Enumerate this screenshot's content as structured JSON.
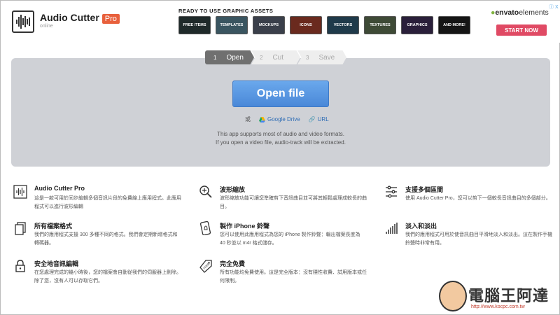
{
  "app": {
    "name": "Audio Cutter",
    "badge": "Pro",
    "status": "online"
  },
  "ad": {
    "title": "READY TO USE GRAPHIC ASSETS",
    "tiles": [
      {
        "label": "FREE ITEMS",
        "color": "#1f2a2a"
      },
      {
        "label": "TEMPLATES",
        "color": "#3a5560"
      },
      {
        "label": "MOCKUPS",
        "color": "#3a3f4a"
      },
      {
        "label": "ICONS",
        "color": "#6a2a1e"
      },
      {
        "label": "VECTORS",
        "color": "#1f3a4a"
      },
      {
        "label": "TEXTURES",
        "color": "#3e4a36"
      },
      {
        "label": "GRAPHICS",
        "color": "#2a1f3a"
      },
      {
        "label": "AND MORE!",
        "color": "#151515"
      }
    ],
    "brand_prefix": "envato",
    "brand_suffix": "elements",
    "cta": "START NOW",
    "close": "ⓘ X"
  },
  "steps": [
    {
      "num": "1",
      "label": "Open",
      "active": true
    },
    {
      "num": "2",
      "label": "Cut",
      "active": false
    },
    {
      "num": "3",
      "label": "Save",
      "active": false
    }
  ],
  "main": {
    "open_button": "Open file",
    "or": "或",
    "google_drive": "Google Drive",
    "url": "URL",
    "info_line1": "This app supports most of audio and video formats.",
    "info_line2": "If you open a video file, audio-track will be extracted."
  },
  "features": [
    {
      "icon": "waveform-icon",
      "title": "Audio Cutter Pro",
      "desc": "這是一款可用於同步編輯多個音訊片段的免費線上應用程式。此應用程式可以進行波形編輯"
    },
    {
      "icon": "zoom-in-icon",
      "title": "波形縮放",
      "desc": "波形縮放功能可讓您準確剪下音訊曲目並可將其輕鬆處理成較長的曲目。"
    },
    {
      "icon": "sliders-icon",
      "title": "支援多個區間",
      "desc": "使用 Audio Cutter Pro，您可以剪下一個較長音訊曲目的多個部分。"
    },
    {
      "icon": "files-icon",
      "title": "所有檔案格式",
      "desc": "我們的應用程式支援 300 多種不同的格式。我們會定期新增格式和轉碼器。"
    },
    {
      "icon": "phone-bell-icon",
      "title": "製作 iPhone 鈴聲",
      "desc": "您可以使用此應用程式為您的 iPhone 製作鈴聲：輸出檔案長度為 40 秒並以 m4r 格式儲存。"
    },
    {
      "icon": "fade-bars-icon",
      "title": "淡入和淡出",
      "desc": "我們的應用程式可用於使音訊曲目平滑地淡入和淡出。這在製作手機鈴聲時非常有用。"
    },
    {
      "icon": "lock-icon",
      "title": "安全地音訊編輯",
      "desc": "在您處理完成的幾小時後，您的檔案會自動從我們的伺服器上刪除。除了您，沒有人可以存取它們。"
    },
    {
      "icon": "free-tag-icon",
      "title": "完全免費",
      "desc": "所有功能均免費使用。這是完全版本：沒有隱性收費、試用版本或任何限制。"
    }
  ],
  "watermark": {
    "text": "電腦王阿達",
    "url": "http://www.kocpc.com.tw"
  }
}
